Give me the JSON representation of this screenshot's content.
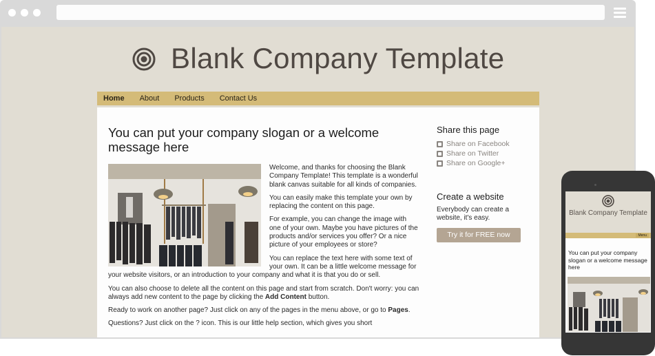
{
  "browser": {
    "url": "",
    "menu_icon": "hamburger-icon"
  },
  "site": {
    "title": "Blank Company Template",
    "logo_icon": "concentric-circles-icon",
    "colors": {
      "background": "#e1ddd3",
      "nav": "#d4bb78",
      "title": "#4f4843",
      "button": "#b4a593",
      "link_muted": "#8a8580"
    }
  },
  "nav": {
    "items": [
      {
        "label": "Home",
        "active": true
      },
      {
        "label": "About",
        "active": false
      },
      {
        "label": "Products",
        "active": false
      },
      {
        "label": "Contact Us",
        "active": false
      }
    ]
  },
  "main": {
    "slogan": "You can put your company slogan or a welcome message here",
    "image_alt": "Clothing store interior with hanging lamps and clothing racks",
    "paragraphs": [
      "Welcome, and thanks for choosing the Blank Company Template! This template is a wonderful blank canvas suitable for all kinds of companies.",
      "You can easily make this template your own by replacing the content on this page.",
      "For example, you can change the image with one of your own. Maybe you have pictures of the products and/or services you offer? Or a nice picture of your employees or store?",
      "You can replace the text here with some text of your own. It can be a little welcome message for your website visitors, or an introduction to your company and what it is that you do or sell."
    ],
    "p5_pre": "You can also choose to delete all the content on this page and start from scratch. Don't worry: you can always add new content to the page by clicking the ",
    "p5_bold": "Add Content",
    "p5_post": " button.",
    "p6_pre": "Ready to work on another page? Just click on any of the pages in the menu above, or go to ",
    "p6_bold": "Pages",
    "p6_post": ".",
    "p7": "Questions? Just click on the ? icon. This is our little help section, which gives you short"
  },
  "sidebar": {
    "share_title": "Share this page",
    "share_links": [
      {
        "label": "Share on Facebook",
        "icon": "facebook-icon"
      },
      {
        "label": "Share on Twitter",
        "icon": "twitter-icon"
      },
      {
        "label": "Share on Google+",
        "icon": "google-plus-icon"
      }
    ],
    "create_title": "Create a website",
    "create_text": "Everybody can create a website, it's easy.",
    "cta_label": "Try it for FREE now"
  },
  "phone": {
    "title": "Blank Company Template",
    "menu_label": "Menu",
    "slogan": "You can put your company slogan or a welcome message here"
  }
}
